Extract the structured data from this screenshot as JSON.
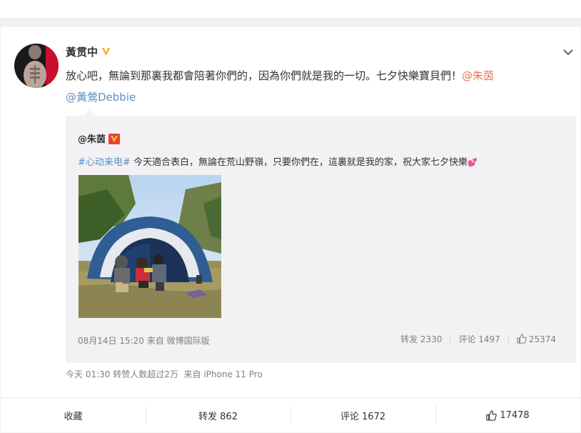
{
  "post": {
    "author": "黃贯中",
    "verified_icon": "verified-v-badge",
    "text_main": "放心吧，無論到那裏我都會陪著你們的，因為你們就是我的一切。七夕快樂寶貝們！",
    "mention_1": "@朱茵",
    "mention_2": "@黃鶯Debbie",
    "meta_time": "今天 01:30",
    "meta_note": "转赞人数超过2万",
    "meta_source": "来自 iPhone 11 Pro"
  },
  "repost": {
    "author": "@朱茵",
    "hashtag": "#心动来电#",
    "text": "今天適合表白，無論在荒山野嶺，只要你們在，這裏就是我的家，祝大家七夕快樂",
    "emoji": "💕",
    "time": "08月14日 15:20",
    "source": "来自 微博国际版",
    "repost_label": "转发 2330",
    "comment_label": "评论 1497",
    "like_count": "25374"
  },
  "actions": {
    "favorite": "收藏",
    "repost": "转发 862",
    "comment": "评论 1672",
    "like": "17478"
  },
  "colors": {
    "link_blue": "#5d8fc5",
    "link_orange": "#eb7350",
    "badge_gold": "#f5a623",
    "badge_red": "#e8412e"
  }
}
